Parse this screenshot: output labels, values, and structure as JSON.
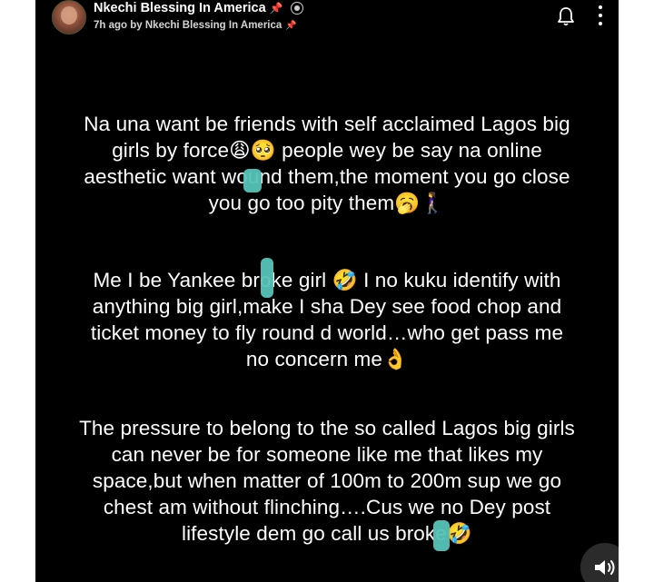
{
  "header": {
    "name": "Nkechi Blessing In America",
    "pin_icon": "pushpin-icon",
    "badge_icon": "verified-badge-icon",
    "subtitle": "7h ago by Nkechi Blessing In America",
    "bell_icon": "bell-icon",
    "more_icon": "more-vertical-icon"
  },
  "story": {
    "paragraphs": [
      {
        "lines": [
          "Na una want be friends with self acclaimed Lagos big",
          "girls by force😩🥺 people wey be say na online",
          "aesthetic want wound them,the moment you go close",
          "you go too pity them🥱🚶‍♀️"
        ]
      },
      {
        "lines": [
          "Me I be Yankee broke girl 🤣 I no kuku identify with",
          "anything big girl,make I sha Dey see food chop and",
          "ticket money to fly round d world…who get pass me",
          "no concern me👌"
        ]
      },
      {
        "lines": [
          "The pressure to belong to the so called Lagos big girls",
          "can never be for someone like me that likes my",
          "space,but when matter of 100m to 200m sup we go",
          "chest am without flinching….Cus we no Dey post",
          "lifestyle dem go call us broke🤣"
        ]
      }
    ]
  },
  "controls": {
    "sound_icon": "speaker-icon"
  },
  "colors": {
    "background": "#000000",
    "text": "#ffffff",
    "redaction_blob": "#56c3b8",
    "pin": "#e0453a"
  }
}
